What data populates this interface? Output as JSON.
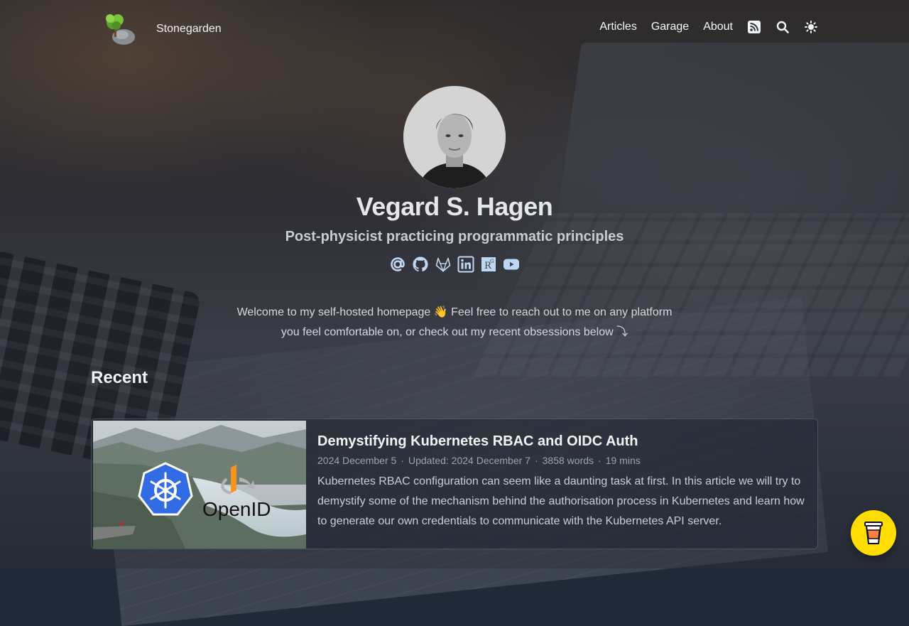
{
  "site": {
    "title": "Stonegarden"
  },
  "nav": {
    "items": [
      "Articles",
      "Garage",
      "About"
    ],
    "icons": [
      "rss-icon",
      "search-icon",
      "theme-toggle-icon"
    ]
  },
  "profile": {
    "name": "Vegard S. Hagen",
    "tagline": "Post-physicist practicing programmatic principles",
    "socials": [
      "email-icon",
      "github-icon",
      "gitlab-icon",
      "linkedin-icon",
      "researchgate-icon",
      "youtube-icon"
    ]
  },
  "intro": {
    "line1": "Welcome to my self-hosted homepage 👋 Feel free to reach out to me on any platform",
    "line2": "you feel comfortable on, or check out my recent obsessions below ⤵"
  },
  "recent": {
    "heading": "Recent",
    "articles": [
      {
        "title": "Demystifying Kubernetes RBAC and OIDC Auth",
        "date": "2024 December 5",
        "updated": "Updated: 2024 December 7",
        "words": "3858 words",
        "read_time": "19 mins",
        "summary": "Kubernetes RBAC configuration can seem like a daunting task at first. In this article we will try to demystify some of the mechanism behind the authorisation process in Kubernetes and learn how to generate our own credentials to communicate with the Kubernetes API server.",
        "thumbnail_text": "OpenID"
      }
    ]
  },
  "colors": {
    "accent_icon": "#bfd7f2",
    "coffee_button": "#ffdd00",
    "kubernetes_blue": "#326ce5"
  }
}
